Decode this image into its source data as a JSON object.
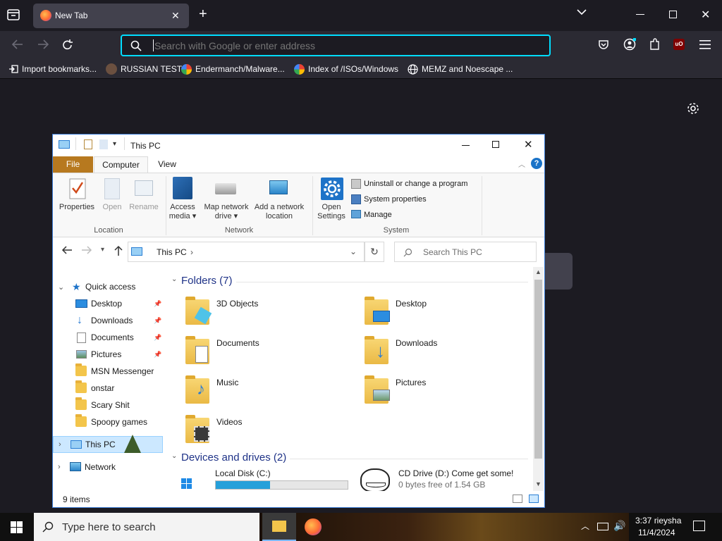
{
  "browser": {
    "tab_title": "New Tab",
    "url_placeholder": "Search with Google or enter address",
    "bookmarks": [
      "Import bookmarks...",
      "RUSSIAN TEST",
      "Endermanch/Malware...",
      "Index of /ISOs/Windows",
      "MEMZ and Noescape ..."
    ]
  },
  "explorer": {
    "title": "This PC",
    "ribbon_tabs": [
      "File",
      "Computer",
      "View"
    ],
    "ribbon": {
      "properties": "Properties",
      "open": "Open",
      "rename": "Rename",
      "group_location": "Location",
      "access_media_1": "Access",
      "access_media_2": "media",
      "map_drive_1": "Map network",
      "map_drive_2": "drive",
      "add_location_1": "Add a network",
      "add_location_2": "location",
      "group_network": "Network",
      "open_settings_1": "Open",
      "open_settings_2": "Settings",
      "uninstall": "Uninstall or change a program",
      "system_properties": "System properties",
      "manage": "Manage",
      "group_system": "System"
    },
    "address": "This PC",
    "search_placeholder": "Search This PC",
    "nav": {
      "quick_access": "Quick access",
      "items": [
        "Desktop",
        "Downloads",
        "Documents",
        "Pictures",
        "MSN Messenger",
        "onstar",
        "Scary Shit",
        "Spoopy games"
      ],
      "this_pc": "This PC",
      "network": "Network"
    },
    "folders_header": "Folders (7)",
    "folders": [
      "3D Objects",
      "Desktop",
      "Documents",
      "Downloads",
      "Music",
      "Pictures",
      "Videos"
    ],
    "devices_header": "Devices and drives (2)",
    "drives": [
      {
        "name": "Local Disk (C:)",
        "used_fraction": 0.41
      },
      {
        "name": "CD Drive (D:) Come get some!",
        "detail": "0 bytes free of 1.54 GB"
      }
    ],
    "status": "9 items"
  },
  "taskbar": {
    "search_placeholder": "Type here to search",
    "time": "3:37 rieysha",
    "date": "11/4/2024"
  },
  "colors": {
    "accent": "#00ddff",
    "file_tab": "#b7791f",
    "selection": "#cce8ff",
    "drive_bar": "#26a0da"
  }
}
